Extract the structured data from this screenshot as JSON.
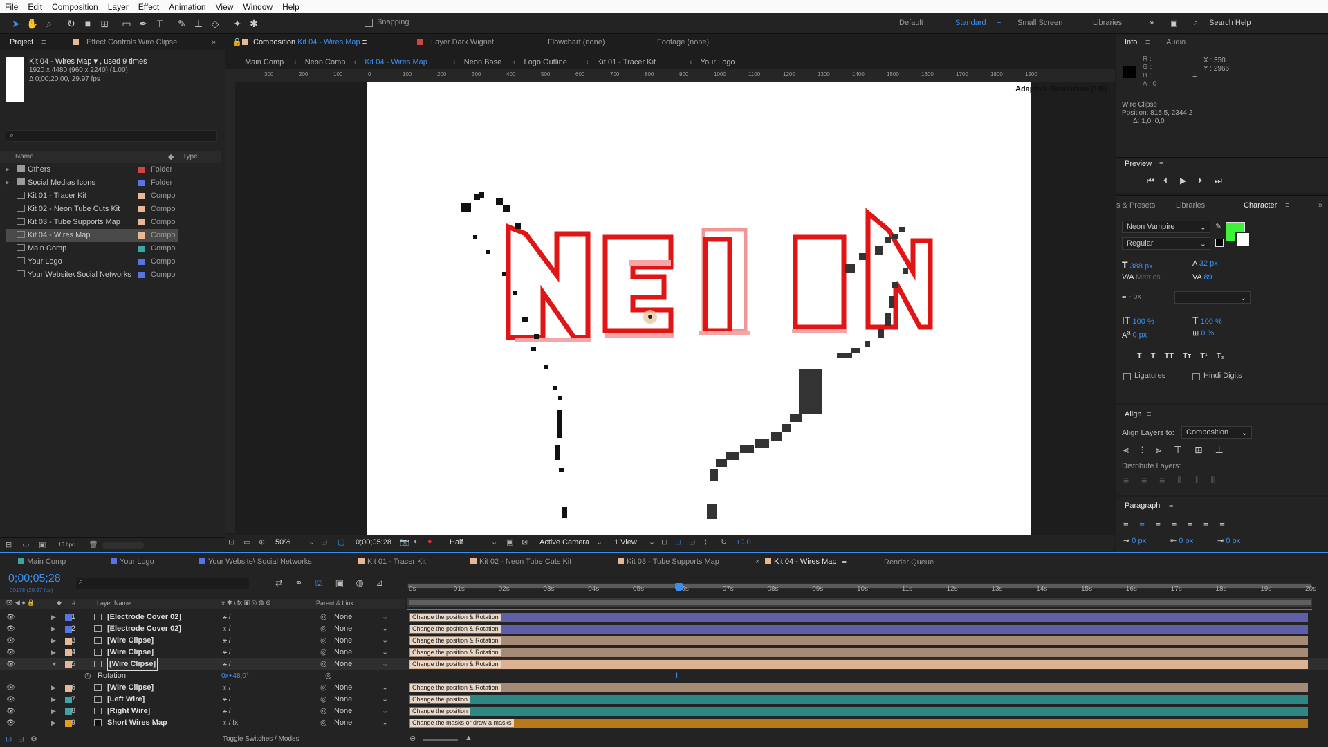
{
  "menu": [
    "File",
    "Edit",
    "Composition",
    "Layer",
    "Effect",
    "Animation",
    "View",
    "Window",
    "Help"
  ],
  "toolbar": {
    "snapping": "Snapping",
    "workspaces": [
      "Default",
      "Standard",
      "Small Screen",
      "Libraries"
    ],
    "active_workspace": "Standard",
    "search_placeholder": "Search Help"
  },
  "project": {
    "tab": "Project",
    "effect_tab": "Effect Controls Wire Clipse",
    "comp_name": "Kit 04 - Wires Map",
    "used": ", used 9 times",
    "dims": "1920 x 4480  (960 x 2240) (1.00)",
    "duration": "Δ 0;00;20;00, 29.97 fps",
    "col_name": "Name",
    "col_type": "Type",
    "items": [
      {
        "name": "Others",
        "type": "Folder",
        "color": "#d24444",
        "kind": "folder"
      },
      {
        "name": "Social Medias Icons",
        "type": "Folder",
        "color": "#5574ea",
        "kind": "folder"
      },
      {
        "name": "Kit 01 - Tracer Kit",
        "type": "Compo",
        "color": "#e8b796",
        "kind": "comp"
      },
      {
        "name": "Kit 02 - Neon Tube Cuts Kit",
        "type": "Compo",
        "color": "#e8b796",
        "kind": "comp"
      },
      {
        "name": "Kit 03 - Tube Supports Map",
        "type": "Compo",
        "color": "#e8b796",
        "kind": "comp"
      },
      {
        "name": "Kit 04 - Wires Map",
        "type": "Compo",
        "color": "#e8b796",
        "kind": "comp",
        "selected": true
      },
      {
        "name": "Main Comp",
        "type": "Compo",
        "color": "#3ba6a3",
        "kind": "comp"
      },
      {
        "name": "Your Logo",
        "type": "Compo",
        "color": "#5574ea",
        "kind": "comp"
      },
      {
        "name": "Your Website\\ Social Networks",
        "type": "Compo",
        "color": "#5574ea",
        "kind": "comp"
      }
    ],
    "bpc": "16 bpc"
  },
  "composition": {
    "tab_prefix": "Composition",
    "tab_name": "Kit 04 - Wires Map",
    "layer_tab": "Layer Dark Wignet",
    "flowchart": "Flowchart (none)",
    "footage": "Footage (none)",
    "breadcrumbs": [
      "Main Comp",
      "Neon Comp",
      "Kit 04 - Wires Map",
      "Neon Base",
      "Logo Outline",
      "Kit 01 - Tracer Kit",
      "Your Logo"
    ],
    "adaptive": "Adaptive Resolution (1/8)",
    "ruler": [
      "300",
      "200",
      "100",
      "0",
      "100",
      "200",
      "300",
      "400",
      "500",
      "600",
      "700",
      "800",
      "900",
      "1000",
      "1100",
      "1200",
      "1300",
      "1400",
      "1500",
      "1600",
      "1700",
      "1800",
      "1900"
    ],
    "zoom": "50%",
    "timecode": "0;00;05;28",
    "resolution": "Half",
    "camera": "Active Camera",
    "views": "1 View",
    "exposure": "+0.0"
  },
  "info": {
    "tab": "Info",
    "audio": "Audio",
    "rgba": [
      "R :",
      "G :",
      "B :",
      "A : 0"
    ],
    "x": "X : 350",
    "y": "Y : 2966",
    "layer": "Wire Clipse",
    "position": "Position: 815,5, 2344,2",
    "delta": "Δ: 1,0, 0,0"
  },
  "preview": {
    "title": "Preview"
  },
  "character": {
    "tabs": [
      "s & Presets",
      "Libraries",
      "Character"
    ],
    "font": "Neon Vampire",
    "style": "Regular",
    "size": "388 px",
    "leading": "32 px",
    "kerning": "Metrics",
    "tracking": "89",
    "stroke": "- px",
    "vscale": "100 %",
    "hscale": "100 %",
    "baseline": "0 px",
    "tsume": "0 %",
    "fmt": [
      "T",
      "T",
      "TT",
      "Tт",
      "T¹",
      "T₁"
    ],
    "ligatures": "Ligatures",
    "hindi": "Hindi Digits",
    "fill": "#3ef23a"
  },
  "align": {
    "title": "Align",
    "align_to_label": "Align Layers to:",
    "align_to": "Composition",
    "distribute": "Distribute Layers:"
  },
  "paragraph": {
    "title": "Paragraph",
    "indent1": "0 px",
    "indent2": "0 px",
    "indent3": "0 px"
  },
  "timeline": {
    "tabs": [
      {
        "name": "Main Comp",
        "color": "#3ba6a3"
      },
      {
        "name": "Your Logo",
        "color": "#5574ea"
      },
      {
        "name": "Your Website\\ Social Networks",
        "color": "#5574ea"
      },
      {
        "name": "Kit 01 - Tracer Kit",
        "color": "#e8b796"
      },
      {
        "name": "Kit 02 - Neon Tube Cuts Kit",
        "color": "#e8b796"
      },
      {
        "name": "Kit 03 - Tube Supports Map",
        "color": "#e8b796"
      },
      {
        "name": "Kit 04 - Wires Map",
        "color": "#e8b796"
      }
    ],
    "render_queue": "Render Queue",
    "timecode": "0;00;05;28",
    "fps": "00178 (29.97 fps)",
    "col_layer": "Layer Name",
    "col_parent": "Parent & Link",
    "ruler": [
      "0s",
      "01s",
      "02s",
      "03s",
      "04s",
      "05s",
      "06s",
      "07s",
      "08s",
      "09s",
      "10s",
      "11s",
      "12s",
      "13s",
      "14s",
      "15s",
      "16s",
      "17s",
      "18s",
      "19s",
      "20s"
    ],
    "layers": [
      {
        "num": "1",
        "name": "[Electrode Cover 02]",
        "color": "#5574ea",
        "parent": "None",
        "bar": "#5f5fa8",
        "label": "Change the position & Rotation"
      },
      {
        "num": "2",
        "name": "[Electrode Cover 02]",
        "color": "#5574ea",
        "parent": "None",
        "bar": "#5f5fa8",
        "label": "Change the position & Rotation"
      },
      {
        "num": "3",
        "name": "[Wire Clipse]",
        "color": "#e8b796",
        "parent": "None",
        "bar": "#a58a76",
        "label": "Change the position & Rotation"
      },
      {
        "num": "4",
        "name": "[Wire Clipse]",
        "color": "#e8b796",
        "parent": "None",
        "bar": "#a58a76",
        "label": "Change the position & Rotation"
      },
      {
        "num": "5",
        "name": "[Wire Clipse]",
        "color": "#e8b796",
        "parent": "None",
        "bar": "#dcb295",
        "label": "Change the position & Rotation",
        "selected": true
      },
      {
        "num": "6",
        "name": "[Wire Clipse]",
        "color": "#e8b796",
        "parent": "None",
        "bar": "#a58a76",
        "label": "Change the position & Rotation"
      },
      {
        "num": "7",
        "name": "[Left Wire]",
        "color": "#3ba6a3",
        "parent": "None",
        "bar": "#2f8783",
        "label": "Change the position"
      },
      {
        "num": "8",
        "name": "[Right Wire]",
        "color": "#3ba6a3",
        "parent": "None",
        "bar": "#2f8783",
        "label": "Change the position"
      },
      {
        "num": "9",
        "name": "Short Wires Map",
        "color": "#e89a1c",
        "parent": "None",
        "bar": "#b67a1a",
        "label": "Change the masks or draw a masks"
      }
    ],
    "sub_property": "Rotation",
    "sub_value": "0x+48,0°",
    "footer": "Toggle Switches / Modes",
    "playhead": 0.298
  }
}
